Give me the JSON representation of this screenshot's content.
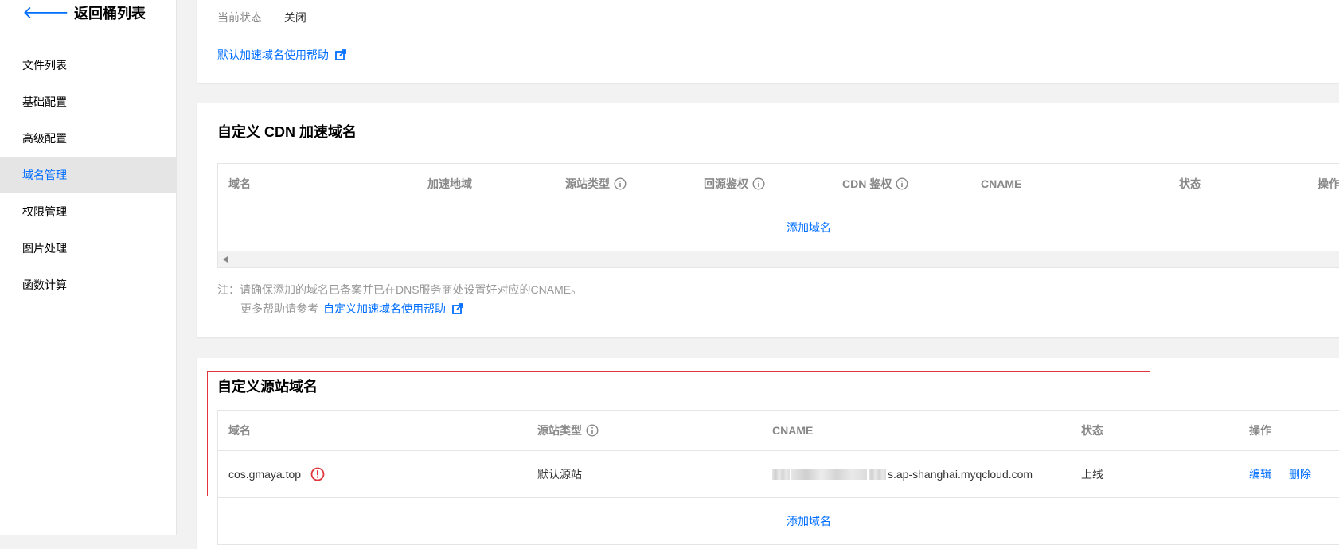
{
  "sidebar": {
    "back_label": "返回桶列表",
    "items": [
      {
        "label": "文件列表"
      },
      {
        "label": "基础配置"
      },
      {
        "label": "高级配置"
      },
      {
        "label": "域名管理",
        "active": true
      },
      {
        "label": "权限管理"
      },
      {
        "label": "图片处理"
      },
      {
        "label": "函数计算"
      }
    ]
  },
  "default_domain": {
    "status_label": "当前状态",
    "status_value": "关闭",
    "help_link": "默认加速域名使用帮助"
  },
  "cdn": {
    "title": "自定义 CDN 加速域名",
    "columns": [
      "域名",
      "加速地域",
      "源站类型",
      "回源鉴权",
      "CDN 鉴权",
      "CNAME",
      "状态",
      "操作"
    ],
    "add_label": "添加域名",
    "note_line1": "注：请确保添加的域名已备案并已在DNS服务商处设置好对应的CNAME。",
    "note_line2": "更多帮助请参考",
    "help_link": "自定义加速域名使用帮助"
  },
  "origin": {
    "title": "自定义源站域名",
    "columns": [
      "域名",
      "源站类型",
      "CNAME",
      "状态",
      "操作"
    ],
    "rows": [
      {
        "domain": "cos.gmaya.top",
        "origin_type": "默认源站",
        "cname_suffix": "s.ap-shanghai.myqcloud.com",
        "status": "上线",
        "edit": "编辑",
        "delete": "删除"
      }
    ],
    "add_label": "添加域名"
  },
  "colors": {
    "accent": "#006eff",
    "highlight": "#e1363c",
    "warning": "#e1363c"
  }
}
